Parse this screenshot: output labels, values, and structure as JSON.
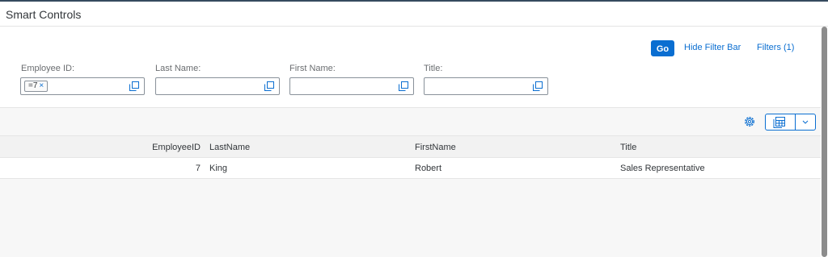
{
  "header": {
    "title": "Smart Controls"
  },
  "filterbar": {
    "go_label": "Go",
    "hide_label": "Hide Filter Bar",
    "filters_label": "Filters (1)",
    "fields": [
      {
        "label": "Employee ID:",
        "token": "=7",
        "value": ""
      },
      {
        "label": "Last Name:",
        "value": ""
      },
      {
        "label": "First Name:",
        "value": ""
      },
      {
        "label": "Title:",
        "value": ""
      }
    ]
  },
  "table": {
    "columns": [
      "EmployeeID",
      "LastName",
      "FirstName",
      "Title"
    ],
    "rows": [
      {
        "id": "7",
        "last": "King",
        "first": "Robert",
        "title": "Sales Representative"
      }
    ]
  },
  "icons": {
    "value_help": "value-help-icon",
    "token_remove": "×",
    "settings": "gear-icon",
    "export": "export-spreadsheet-icon",
    "dropdown": "chevron-down-icon"
  },
  "colors": {
    "accent": "#0a6ed1",
    "shell": "#354a5f"
  }
}
